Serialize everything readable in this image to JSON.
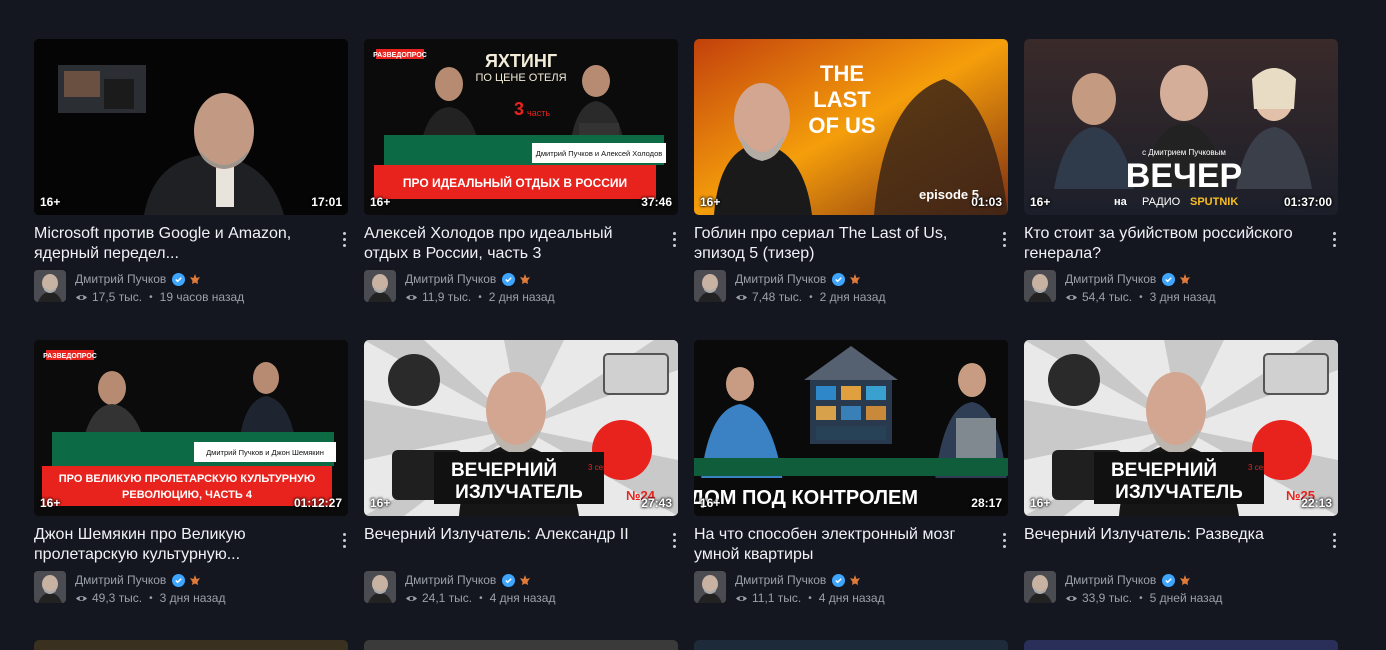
{
  "channel_name": "Дмитрий Пучков",
  "age_rating": "16+",
  "videos": [
    {
      "title": "Microsoft против Google и Amazon, ядерный передел...",
      "duration": "17:01",
      "views": "17,5 тыс.",
      "time": "19 часов назад"
    },
    {
      "title": "Алексей Холодов про идеальный отдых в России, часть 3",
      "duration": "37:46",
      "views": "11,9 тыс.",
      "time": "2 дня назад",
      "thumb_text": {
        "brand": "РАЗВЕДОПРОС",
        "headline": "ЯХТИНГ",
        "sub": "ПО ЦЕНЕ ОТЕЛЯ",
        "part": "3",
        "part_word": "часть",
        "names": "Дмитрий Пучков и Алексей Холодов",
        "banner": "ПРО ИДЕАЛЬНЫЙ ОТДЫХ В РОССИИ"
      }
    },
    {
      "title": "Гоблин про сериал The Last of Us, эпизод 5 (тизер)",
      "duration": "01:03",
      "views": "7,48 тыс.",
      "time": "2 дня назад",
      "thumb_text": {
        "logo1": "THE",
        "logo2": "LAST",
        "logo3": "OF US",
        "episode": "episode 5"
      }
    },
    {
      "title": "Кто стоит за убийством российского генерала?",
      "duration": "01:37:00",
      "views": "54,4 тыс.",
      "time": "3 дня назад",
      "thumb_text": {
        "small": "с Дмитрием Пучковым",
        "big": "ВЕЧЕР",
        "on": "на",
        "radio": "РАДИО",
        "sputnik": "SPUTNIK"
      }
    },
    {
      "title": "Джон Шемякин про Великую пролетарскую культурную...",
      "duration": "01:12:27",
      "views": "49,3 тыс.",
      "time": "3 дня назад",
      "thumb_text": {
        "brand": "РАЗВЕДОПРОС",
        "names": "Дмитрий Пучков и Джон Шемякин",
        "banner1": "ПРО ВЕЛИКУЮ ПРОЛЕТАРСКУЮ КУЛЬТУРНУЮ",
        "banner2": "РЕВОЛЮЦИЮ, ЧАСТЬ 4"
      }
    },
    {
      "title": "Вечерний Излучатель: Александр II",
      "duration": "27:43",
      "views": "24,1 тыс.",
      "time": "4 дня назад",
      "thumb_text": {
        "line1": "ВЕЧЕРНИЙ",
        "line2": "ИЗЛУЧАТЕЛЬ",
        "season": "3 сезон",
        "num": "№24"
      }
    },
    {
      "title": "На что способен электронный мозг умной квартиры",
      "duration": "28:17",
      "views": "11,1 тыс.",
      "time": "4 дня назад",
      "thumb_text": {
        "banner": "ДОМ ПОД КОНТРОЛЕМ"
      }
    },
    {
      "title": "Вечерний Излучатель: Разведка",
      "duration": "22:13",
      "views": "33,9 тыс.",
      "time": "5 дней назад",
      "thumb_text": {
        "line1": "ВЕЧЕРНИЙ",
        "line2": "ИЗЛУЧАТЕЛЬ",
        "season": "3 сезон",
        "num": "№25"
      }
    }
  ],
  "colors": {
    "background": "#14171f",
    "verified": "#3ea6ff",
    "accent_red": "#e8231d",
    "meta_text": "#9ba0ab"
  },
  "icons": [
    "kebab-menu-icon",
    "verified-icon",
    "crest-icon",
    "eye-icon"
  ]
}
